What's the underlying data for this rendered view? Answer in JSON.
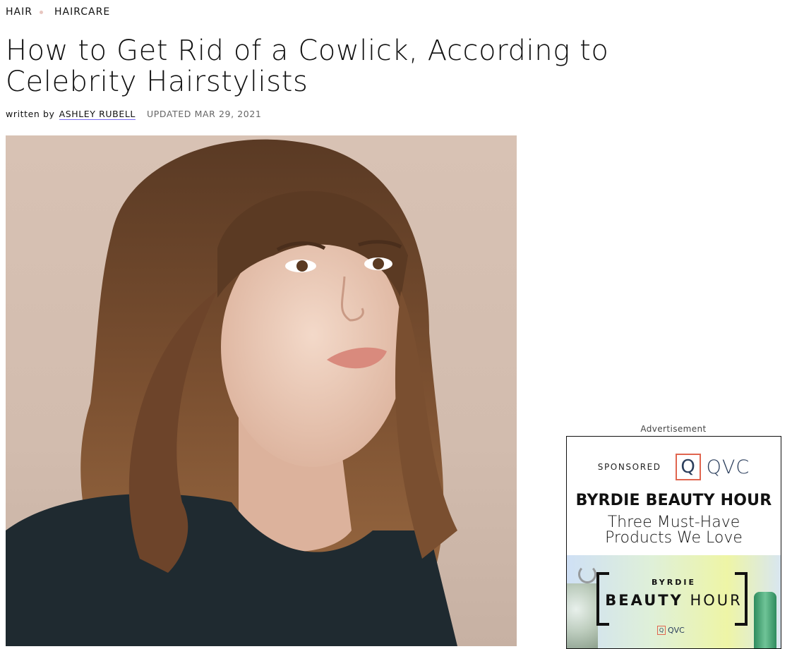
{
  "breadcrumb": {
    "items": [
      "HAIR",
      "HAIRCARE"
    ]
  },
  "article": {
    "title": "How to Get Rid of a Cowlick, According to Celebrity Hairstylists",
    "byline_prefix": "written by",
    "author": "ASHLEY RUBELL",
    "updated": "UPDATED MAR 29, 2021"
  },
  "ad": {
    "label": "Advertisement",
    "sponsored": "SPONSORED",
    "brand_q": "Q",
    "brand": "QVC",
    "headline": "BYRDIE BEAUTY HOUR",
    "subline": [
      "Three Must-Have",
      "Products We Love"
    ],
    "banner": {
      "small": "BYRDIE",
      "big_bold": "BEAUTY",
      "big_light": "HOUR",
      "footer_q": "Q",
      "footer": "QVC"
    }
  },
  "colors": {
    "author_underline": "#7b6cf0",
    "breadcrumb_dot": "#e8c6c0",
    "qvc_accent": "#e0654f",
    "qvc_text": "#2b3e5c"
  }
}
